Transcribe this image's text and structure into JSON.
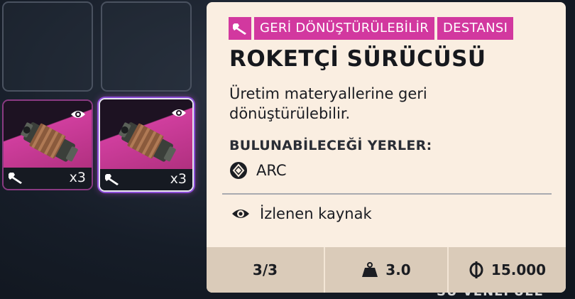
{
  "inventory": {
    "slots": [
      {
        "state": "empty"
      },
      {
        "state": "empty"
      },
      {
        "state": "item",
        "quantity": "x3",
        "watched": true,
        "recyclable": true,
        "rarity_color": "#d03e9e"
      },
      {
        "state": "item",
        "quantity": "x3",
        "watched": true,
        "recyclable": true,
        "rarity_color": "#d03e9e",
        "selected": true
      }
    ]
  },
  "tooltip": {
    "tags": [
      "GERİ DÖNÜŞTÜRÜLEBİLİR",
      "DESTANSI"
    ],
    "tag_color": "#d2389f",
    "title": "ROKETÇİ SÜRÜCÜSÜ",
    "description": "Üretim materyallerine geri dönüştürülebilir.",
    "locations_heading": "BULUNABİLECEĞİ YERLER:",
    "locations": [
      {
        "name": "ARC",
        "icon": "arc-icon"
      }
    ],
    "watch_label": "İzlenen kaynak",
    "stats": {
      "stack": "3/3",
      "weight": "3.0",
      "value": "15.000"
    }
  },
  "background_text": "SU VENEPUEL"
}
